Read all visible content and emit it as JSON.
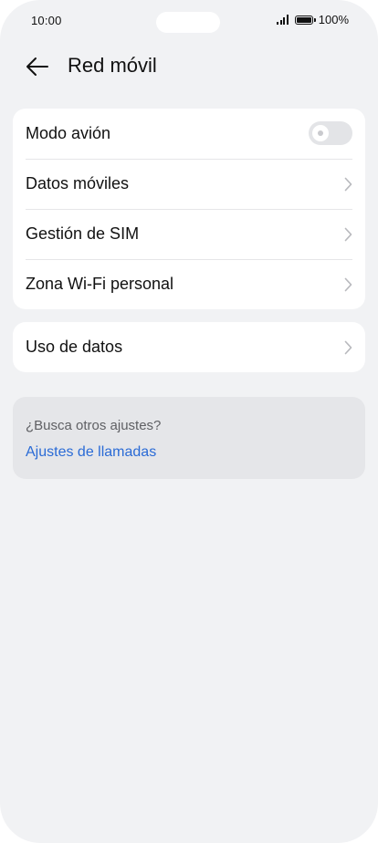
{
  "status_bar": {
    "time": "10:00",
    "battery_percent": "100%",
    "icons": [
      "signal-icon",
      "battery-icon"
    ]
  },
  "header": {
    "title": "Red móvil",
    "back_icon": "arrow-left-icon"
  },
  "settings_group": {
    "items": [
      {
        "label": "Modo avión",
        "control": "toggle",
        "toggle_on": false
      },
      {
        "label": "Datos móviles",
        "control": "chevron-right-icon"
      },
      {
        "label": "Gestión de SIM",
        "control": "chevron-right-icon"
      },
      {
        "label": "Zona Wi-Fi personal",
        "control": "chevron-right-icon"
      }
    ]
  },
  "usage_group": {
    "items": [
      {
        "label": "Uso de datos",
        "control": "chevron-right-icon"
      }
    ]
  },
  "suggestion": {
    "title": "¿Busca otros ajustes?",
    "link": "Ajustes de llamadas"
  },
  "colors": {
    "background": "#f1f2f4",
    "card": "#ffffff",
    "link": "#2a6bd6",
    "toggle_off": "#e3e4e7"
  }
}
